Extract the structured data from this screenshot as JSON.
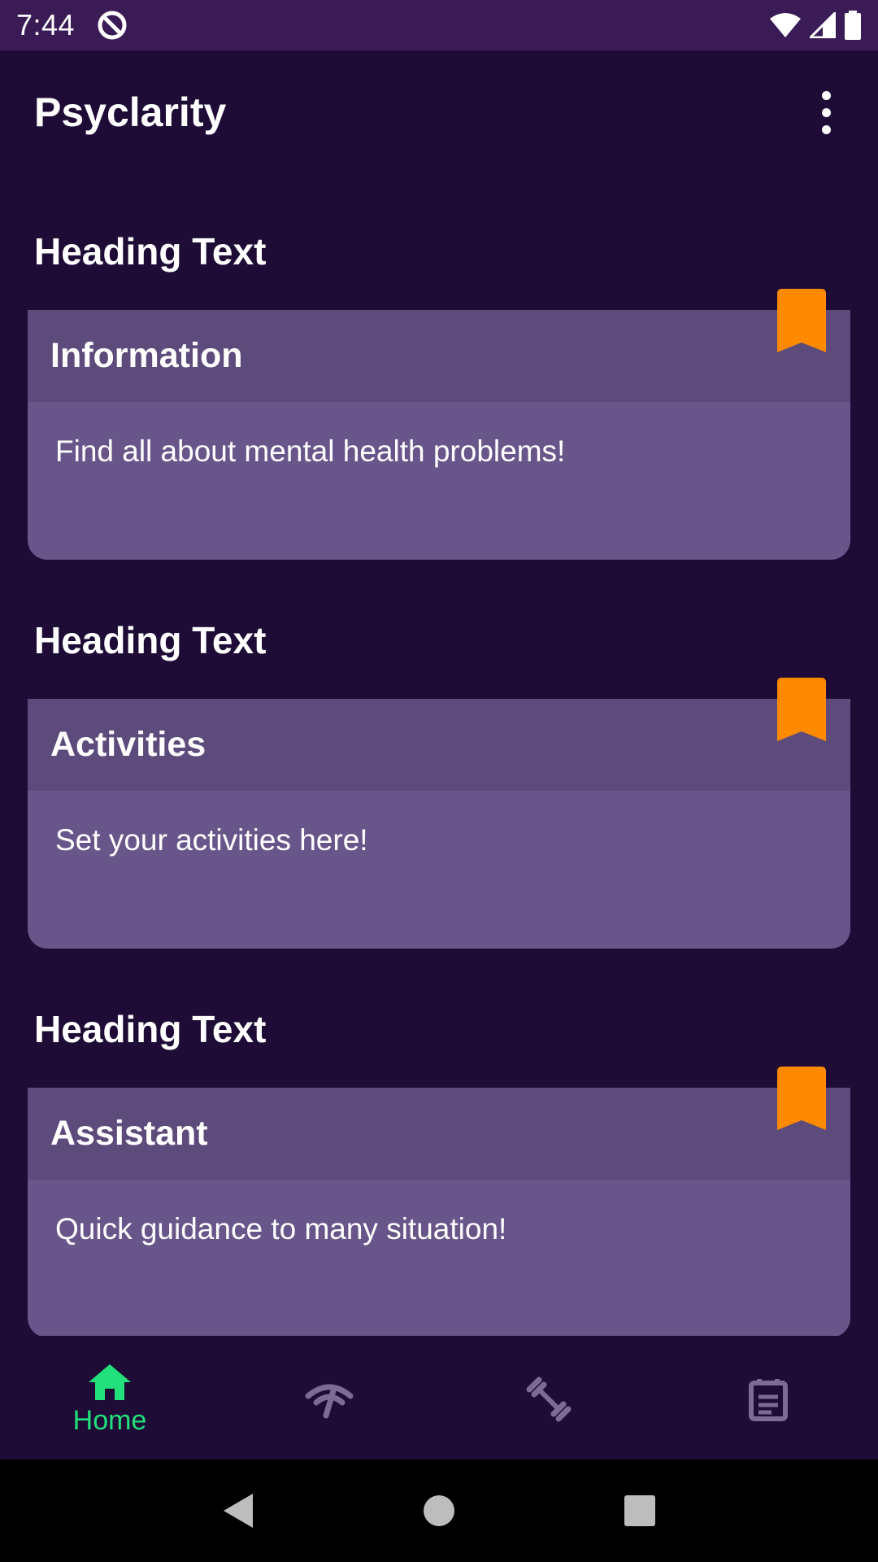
{
  "status_bar": {
    "time": "7:44",
    "icons": [
      "app-notification-icon",
      "wifi-icon",
      "cellular-signal-icon",
      "battery-icon"
    ]
  },
  "app_bar": {
    "title": "Psyclarity",
    "menu_icon": "overflow-menu-icon"
  },
  "sections": [
    {
      "heading": "Heading Text",
      "card_title": "Information",
      "card_text": "Find all about mental health problems!",
      "bookmark_icon": "bookmark-icon"
    },
    {
      "heading": "Heading Text",
      "card_title": "Activities",
      "card_text": "Set your activities here!",
      "bookmark_icon": "bookmark-icon"
    },
    {
      "heading": "Heading Text",
      "card_title": "Assistant",
      "card_text": "Quick guidance to many situation!",
      "bookmark_icon": "bookmark-icon"
    }
  ],
  "bottom_nav": {
    "items": [
      {
        "icon": "home-icon",
        "label": "Home",
        "selected": true
      },
      {
        "icon": "signal-icon",
        "label": "",
        "selected": false
      },
      {
        "icon": "dumbbell-icon",
        "label": "",
        "selected": false
      },
      {
        "icon": "notes-icon",
        "label": "",
        "selected": false
      }
    ]
  },
  "system_nav": {
    "icons": [
      "back-icon",
      "home-circle-icon",
      "recents-icon"
    ]
  },
  "colors": {
    "background": "#1e0c36",
    "status_bar": "#3a1b55",
    "card_header": "#5d4b7c",
    "card_body": "#68568a",
    "bookmark": "#ff8a00",
    "nav_selected": "#22e07b",
    "nav_unselected": "#7d6a97"
  }
}
